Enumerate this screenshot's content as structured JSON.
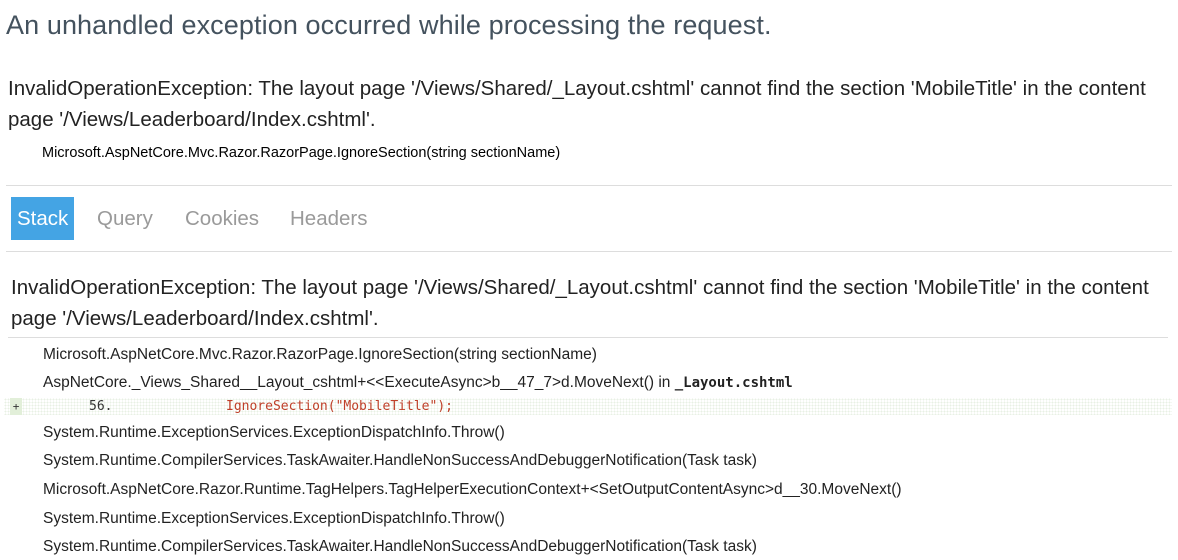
{
  "error_title": "An unhandled exception occurred while processing the request.",
  "title_error": "InvalidOperationException: The layout page '/Views/Shared/_Layout.cshtml' cannot find the section 'MobileTitle' in the content page '/Views/Leaderboard/Index.cshtml'.",
  "location": "Microsoft.AspNetCore.Mvc.Razor.RazorPage.IgnoreSection(string sectionName)",
  "tabs": [
    {
      "label": "Stack",
      "active": true
    },
    {
      "label": "Query",
      "active": false
    },
    {
      "label": "Cookies",
      "active": false
    },
    {
      "label": "Headers",
      "active": false
    }
  ],
  "stack": {
    "heading": "InvalidOperationException: The layout page '/Views/Shared/_Layout.cshtml' cannot find the section 'MobileTitle' in the content page '/Views/Leaderboard/Index.cshtml'.",
    "frames": [
      {
        "method": "Microsoft.AspNetCore.Mvc.Razor.RazorPage.IgnoreSection(string sectionName)"
      },
      {
        "method": "AspNetCore._Views_Shared__Layout_cshtml+<<ExecuteAsync>b__47_7>d.MoveNext() in ",
        "file": "_Layout.cshtml"
      },
      {
        "method": "System.Runtime.ExceptionServices.ExceptionDispatchInfo.Throw()"
      },
      {
        "method": "System.Runtime.CompilerServices.TaskAwaiter.HandleNonSuccessAndDebuggerNotification(Task task)"
      },
      {
        "method": "Microsoft.AspNetCore.Razor.Runtime.TagHelpers.TagHelperExecutionContext+<SetOutputContentAsync>d__30.MoveNext()"
      },
      {
        "method": "System.Runtime.ExceptionServices.ExceptionDispatchInfo.Throw()"
      },
      {
        "method": "System.Runtime.CompilerServices.TaskAwaiter.HandleNonSuccessAndDebuggerNotification(Task task)"
      }
    ],
    "source": {
      "toggle": "+",
      "line_number": "56.",
      "code": "IgnoreSection(\"MobileTitle\");"
    }
  },
  "colors": {
    "active_tab_bg": "#44a4e4",
    "inactive_tab_text": "#9a9a9a",
    "code_text": "#c0402a"
  }
}
